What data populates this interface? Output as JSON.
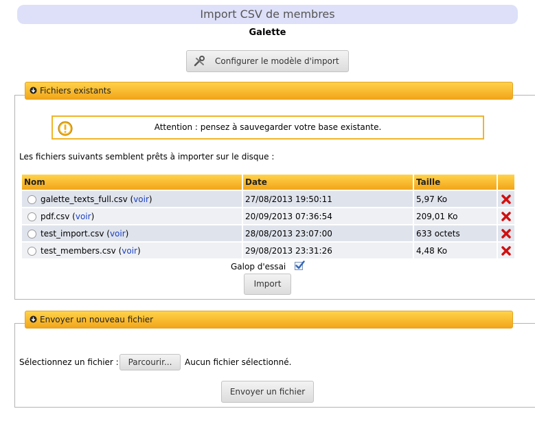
{
  "page": {
    "title": "Import CSV de membres",
    "subtitle": "Galette"
  },
  "config_button": {
    "label": "Configurer le modèle d'import",
    "icon": "tools-icon"
  },
  "existing": {
    "legend": "Fichiers existants",
    "warning": "Attention : pensez à sauvegarder votre base existante.",
    "intro": "Les fichiers suivants semblent prêts à importer sur le disque :",
    "columns": {
      "name": "Nom",
      "date": "Date",
      "size": "Taille"
    },
    "files": [
      {
        "name": "galette_texts_full.csv",
        "link": "voir",
        "date": "27/08/2013 19:50:11",
        "size": "5,97 Ko"
      },
      {
        "name": "pdf.csv",
        "link": "voir",
        "date": "20/09/2013 07:36:54",
        "size": "209,01 Ko"
      },
      {
        "name": "test_import.csv",
        "link": "voir",
        "date": "28/08/2013 23:07:00",
        "size": "633 octets"
      },
      {
        "name": "test_members.csv",
        "link": "voir",
        "date": "29/08/2013 23:31:26",
        "size": "4,48 Ko"
      }
    ],
    "dryrun_label": "Galop d'essai",
    "dryrun_checked": true,
    "import_label": "Import"
  },
  "upload": {
    "legend": "Envoyer un nouveau fichier",
    "select_label": "Sélectionnez un fichier :",
    "browse_label": "Parcourir...",
    "no_file": "Aucun fichier sélectionné.",
    "send_label": "Envoyer un fichier"
  },
  "colors": {
    "title_bg": "#dde0f8",
    "legend_orange": "#f2a51a",
    "link_blue": "#1a3fc4",
    "delete_red": "#d01010"
  }
}
